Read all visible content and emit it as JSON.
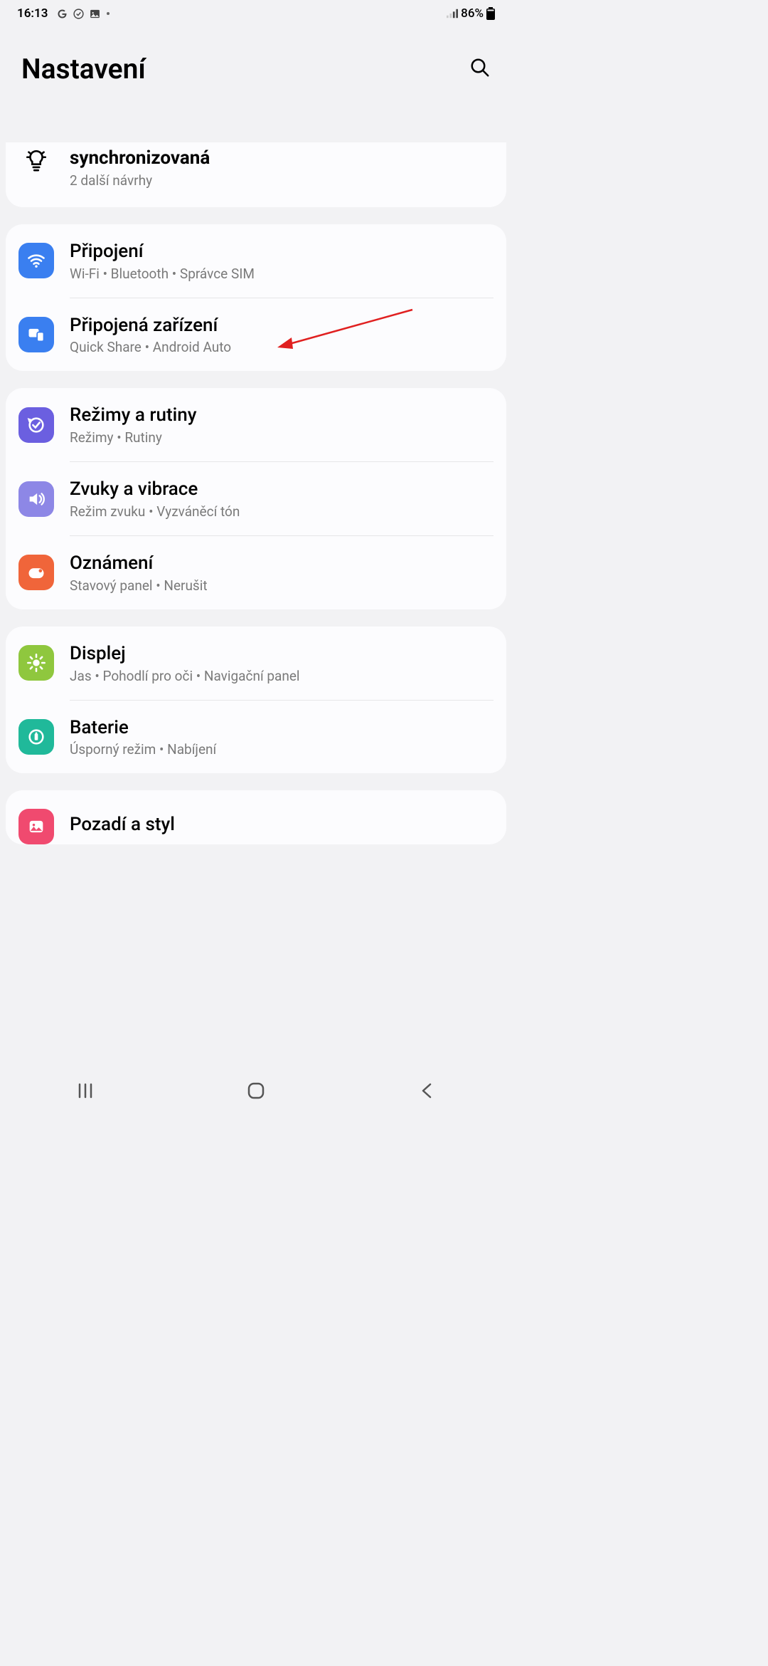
{
  "status": {
    "time": "16:13",
    "battery": "86%"
  },
  "header": {
    "title": "Nastavení"
  },
  "suggestion": {
    "title": "synchronizovaná",
    "sub": "2 další návrhy"
  },
  "groups": [
    {
      "items": [
        {
          "title": "Připojení",
          "sub": "Wi-Fi  •  Bluetooth  •  Správce SIM",
          "icon": "wifi",
          "color": "ic-blue"
        },
        {
          "title": "Připojená zařízení",
          "sub": "Quick Share  •  Android Auto",
          "icon": "devices",
          "color": "ic-blue2"
        }
      ]
    },
    {
      "items": [
        {
          "title": "Režimy a rutiny",
          "sub": "Režimy  •  Rutiny",
          "icon": "routines",
          "color": "ic-purple"
        },
        {
          "title": "Zvuky a vibrace",
          "sub": "Režim zvuku  •  Vyzváněcí tón",
          "icon": "sound",
          "color": "ic-lav"
        },
        {
          "title": "Oznámení",
          "sub": "Stavový panel  •  Nerušit",
          "icon": "notif",
          "color": "ic-orange"
        }
      ]
    },
    {
      "items": [
        {
          "title": "Displej",
          "sub": "Jas  •  Pohodlí pro oči  •  Navigační panel",
          "icon": "display",
          "color": "ic-green"
        },
        {
          "title": "Baterie",
          "sub": "Úsporný režim  •  Nabíjení",
          "icon": "battery",
          "color": "ic-teal"
        }
      ]
    },
    {
      "items": [
        {
          "title": "Pozadí a styl",
          "sub": "",
          "icon": "wallpaper",
          "color": "ic-pink"
        }
      ]
    }
  ]
}
